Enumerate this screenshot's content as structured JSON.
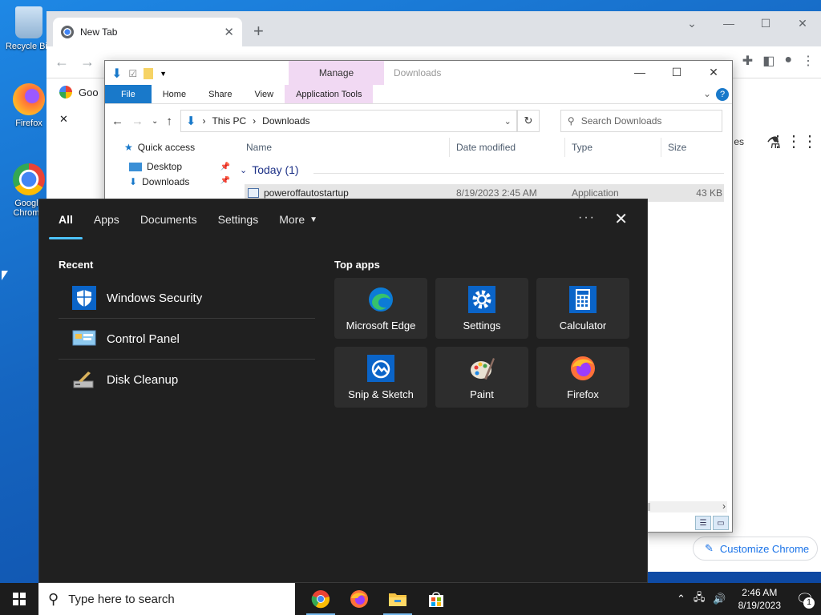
{
  "desktop": {
    "icons": [
      {
        "label": "Recycle Bin",
        "icon": "recycle-bin-icon"
      },
      {
        "label": "Firefox",
        "icon": "firefox-icon"
      },
      {
        "label": "Google Chrome",
        "icon": "chrome-icon"
      }
    ]
  },
  "chrome": {
    "tab_title": "New Tab",
    "bookmark_label": "Goo",
    "partial_label": "es",
    "customize_label": "Customize Chrome"
  },
  "explorer": {
    "manage_label": "Manage",
    "title": "Downloads",
    "ribbon_tabs": [
      "File",
      "Home",
      "Share",
      "View",
      "Application Tools"
    ],
    "breadcrumb": [
      "This PC",
      "Downloads"
    ],
    "search_placeholder": "Search Downloads",
    "nav": [
      {
        "label": "Quick access"
      },
      {
        "label": "Desktop"
      },
      {
        "label": "Downloads"
      }
    ],
    "columns": [
      "Name",
      "Date modified",
      "Type",
      "Size"
    ],
    "group_label": "Today (1)",
    "file": {
      "name": "poweroffautostartup",
      "date": "8/19/2023 2:45 AM",
      "type": "Application",
      "size": "43 KB"
    }
  },
  "search_panel": {
    "tabs": [
      "All",
      "Apps",
      "Documents",
      "Settings",
      "More"
    ],
    "recent_heading": "Recent",
    "top_apps_heading": "Top apps",
    "recent": [
      {
        "label": "Windows Security",
        "icon": "windows-security-icon"
      },
      {
        "label": "Control Panel",
        "icon": "control-panel-icon"
      },
      {
        "label": "Disk Cleanup",
        "icon": "disk-cleanup-icon"
      }
    ],
    "top_apps": [
      {
        "label": "Microsoft Edge",
        "icon": "edge-icon"
      },
      {
        "label": "Settings",
        "icon": "settings-gear-icon"
      },
      {
        "label": "Calculator",
        "icon": "calculator-icon"
      },
      {
        "label": "Snip & Sketch",
        "icon": "snip-sketch-icon"
      },
      {
        "label": "Paint",
        "icon": "paint-icon"
      },
      {
        "label": "Firefox",
        "icon": "firefox-icon"
      }
    ]
  },
  "taskbar": {
    "search_placeholder": "Type here to search",
    "time": "2:46 AM",
    "date": "8/19/2023",
    "notification_count": "1"
  }
}
